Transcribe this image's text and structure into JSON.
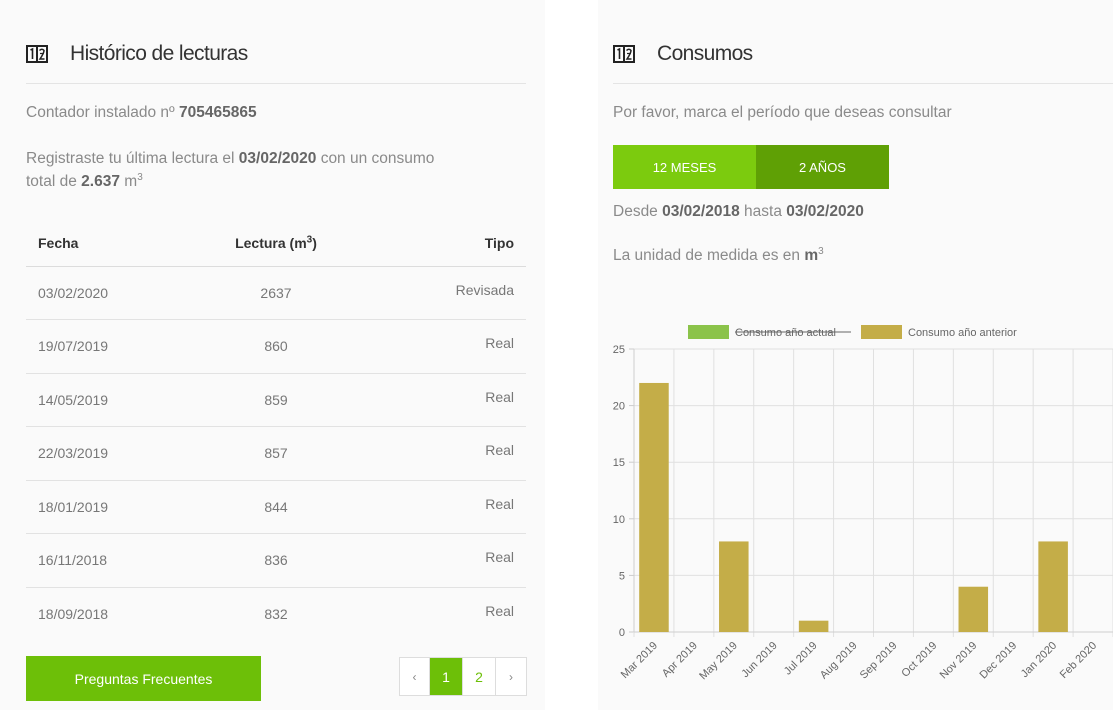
{
  "left": {
    "title": "Histórico de lecturas",
    "header_icon": "meter-reading-icon",
    "meter_label": "Contador instalado nº",
    "meter_number": "705465865",
    "last_reading_prefix": "Registraste tu última lectura el",
    "last_reading_date": "03/02/2020",
    "last_reading_mid": "con un consumo",
    "last_reading_total_label": "total de",
    "last_reading_total": "2.637",
    "unit": "m",
    "unit_exp": "3",
    "table": {
      "col_fecha": "Fecha",
      "col_lectura": "Lectura (m",
      "col_lectura_exp": "3",
      "col_lectura_close": ")",
      "col_tipo": "Tipo",
      "rows": [
        {
          "fecha": "03/02/2020",
          "lectura": "2637",
          "tipo": "Revisada"
        },
        {
          "fecha": "19/07/2019",
          "lectura": "860",
          "tipo": "Real"
        },
        {
          "fecha": "14/05/2019",
          "lectura": "859",
          "tipo": "Real"
        },
        {
          "fecha": "22/03/2019",
          "lectura": "857",
          "tipo": "Real"
        },
        {
          "fecha": "18/01/2019",
          "lectura": "844",
          "tipo": "Real"
        },
        {
          "fecha": "16/11/2018",
          "lectura": "836",
          "tipo": "Real"
        },
        {
          "fecha": "18/09/2018",
          "lectura": "832",
          "tipo": "Real"
        }
      ]
    },
    "faq_button": "Preguntas Frecuentes",
    "pagination": {
      "prev": "‹",
      "pages": [
        "1",
        "2"
      ],
      "active": "1",
      "next": "›"
    }
  },
  "right": {
    "title": "Consumos",
    "header_icon": "meter-reading-icon",
    "prompt": "Por favor, marca el período que deseas consultar",
    "period_12": "12 MESES",
    "period_2y": "2 AÑOS",
    "range_from_label": "Desde",
    "range_from": "03/02/2018",
    "range_to_label": "hasta",
    "range_to": "03/02/2020",
    "unit_label": "La unidad de medida es en",
    "unit": "m",
    "unit_exp": "3"
  },
  "colors": {
    "accent_green": "#6dbf08",
    "series_actual": "#8bc34a",
    "series_previous": "#c4ad48"
  },
  "chart_data": {
    "type": "bar",
    "categories": [
      "Mar 2019",
      "Apr 2019",
      "May 2019",
      "Jun 2019",
      "Jul 2019",
      "Aug 2019",
      "Sep 2019",
      "Oct 2019",
      "Nov 2019",
      "Dec 2019",
      "Jan 2020",
      "Feb 2020"
    ],
    "series": [
      {
        "name": "Consumo año actual",
        "hidden": true,
        "values": [
          null,
          null,
          null,
          null,
          null,
          null,
          null,
          null,
          null,
          null,
          null,
          null
        ]
      },
      {
        "name": "Consumo año anterior",
        "hidden": false,
        "values": [
          22,
          0,
          8,
          0,
          1,
          0,
          0,
          0,
          4,
          0,
          8,
          0
        ]
      }
    ],
    "ylim": [
      0,
      25
    ],
    "yticks": [
      "0",
      "5",
      "10",
      "15",
      "20",
      "25"
    ],
    "grid": true,
    "legend": "top"
  }
}
